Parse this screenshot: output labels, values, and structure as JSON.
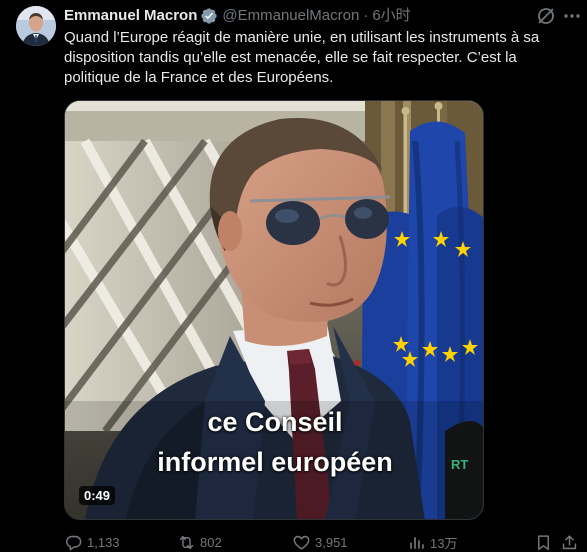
{
  "author": {
    "name": "Emmanuel Macron",
    "handle": "@EmmanuelMacron",
    "separator": "·",
    "time": "6小时"
  },
  "post": {
    "text": "Quand l’Europe réagit de manière unie, en utilisant les instruments à sa disposition tandis qu’elle est menacée, elle se fait respecter. C’est la politique de la France et des Européens."
  },
  "video": {
    "caption_line1": "ce Conseil",
    "caption_line2": "informel européen",
    "duration": "0:49"
  },
  "stats": {
    "replies": "1,133",
    "reposts": "802",
    "likes": "3,951",
    "views": "13万"
  },
  "colors": {
    "background": "#000000",
    "text": "#e7e9ea",
    "secondary": "#71767b",
    "verified": "#1d9bf0",
    "flag_blue": "#1b3f9c",
    "flag_star": "#ffd200"
  },
  "icons": [
    "verified-icon",
    "grok-icon",
    "more-icon",
    "reply-icon",
    "retweet-icon",
    "like-icon",
    "views-icon",
    "bookmark-icon",
    "share-icon"
  ]
}
